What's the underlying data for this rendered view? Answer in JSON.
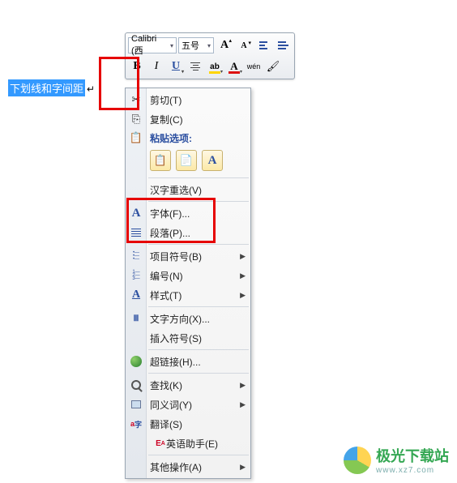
{
  "document": {
    "selected_text": "下划线和字间距"
  },
  "mini_toolbar": {
    "font_name": "Calibri (西",
    "font_size": "五号",
    "grow_font": "A",
    "shrink_font": "A",
    "bold": "B",
    "italic": "I",
    "underline": "U",
    "highlight": "ab",
    "font_color": "A",
    "phonetic": "wén"
  },
  "ctx": {
    "cut": "剪切(T)",
    "copy": "复制(C)",
    "paste_header": "粘贴选项:",
    "paste_opts": {
      "keep_src": "📋",
      "merge": "📄",
      "text_only": "A"
    },
    "reconvert": "汉字重选(V)",
    "font": "字体(F)...",
    "paragraph": "段落(P)...",
    "bullets": "项目符号(B)",
    "numbering": "编号(N)",
    "styles": "样式(T)",
    "text_dir": "文字方向(X)...",
    "insert_sym": "插入符号(S)",
    "hyperlink": "超链接(H)...",
    "find": "查找(K)",
    "synonyms": "同义词(Y)",
    "translate": "翻译(S)",
    "eng_assist": "英语助手(E)",
    "other": "其他操作(A)"
  },
  "watermark": {
    "cn": "极光下载站",
    "en": "www.xz7.com"
  }
}
